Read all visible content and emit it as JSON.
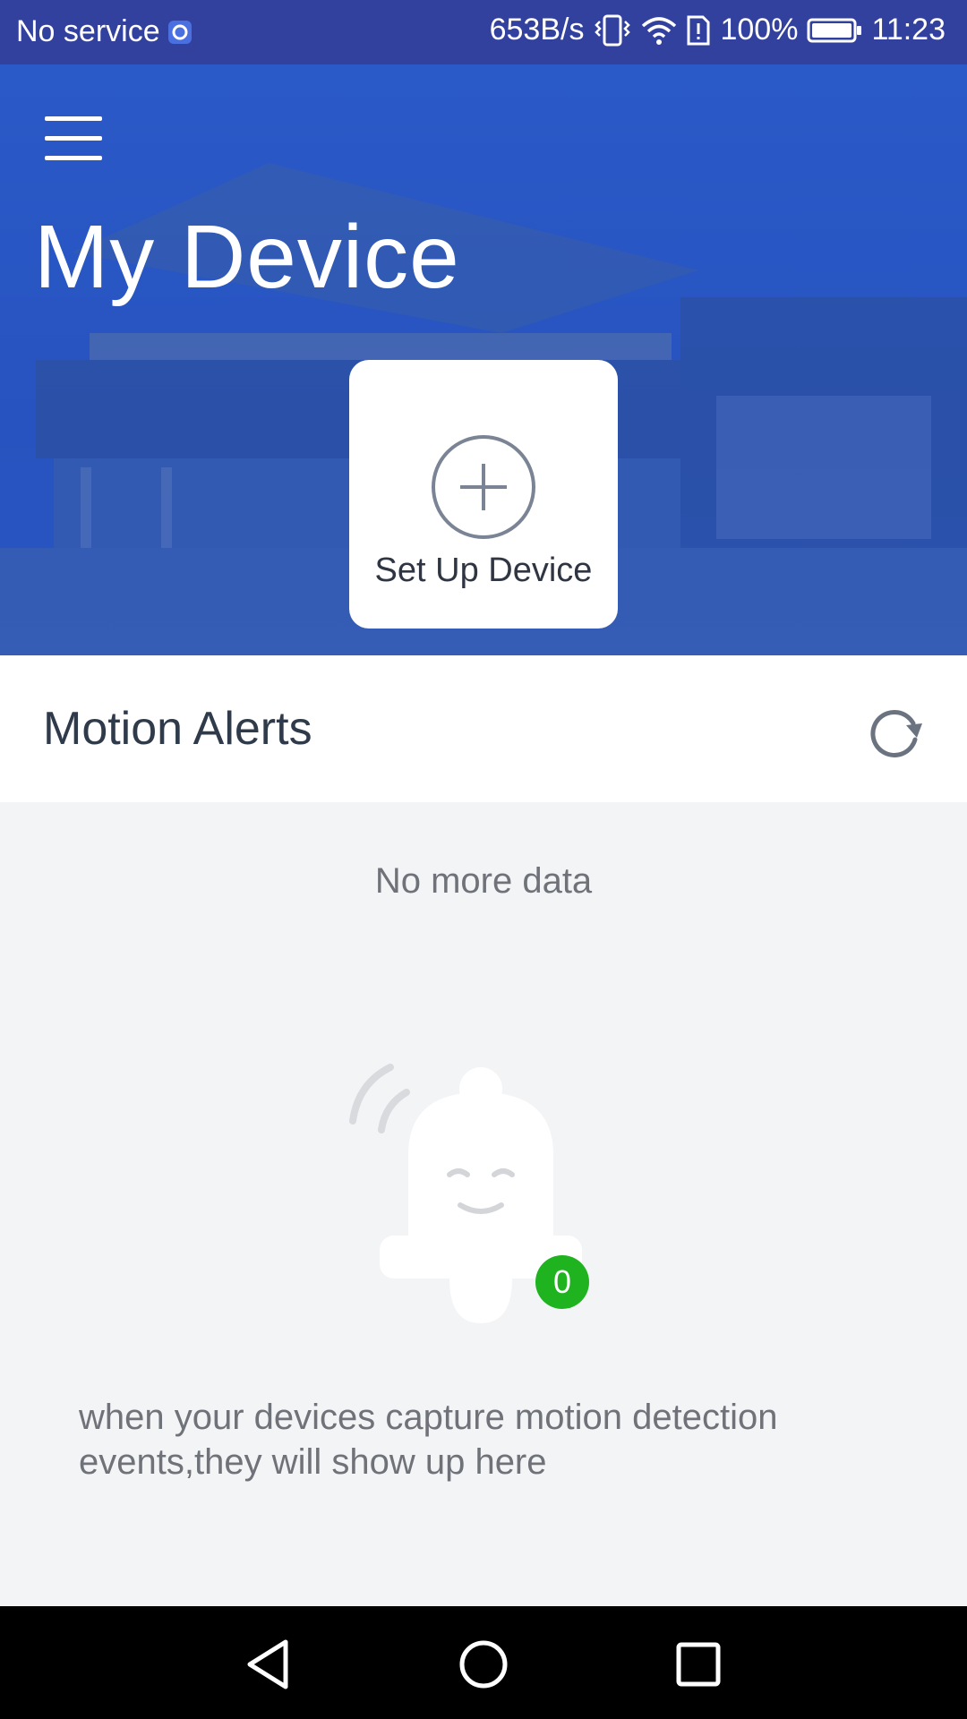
{
  "status_bar": {
    "carrier": "No service",
    "net_speed": "653B/s",
    "battery": "100%",
    "time": "11:23",
    "icons": [
      "sync-icon",
      "vibrate-icon",
      "wifi-icon",
      "sim-alert-icon",
      "battery-icon"
    ]
  },
  "header": {
    "menu_icon": "hamburger-menu-icon",
    "title": "My Device",
    "setup_card": {
      "icon": "plus-circle-icon",
      "label": "Set Up Device"
    }
  },
  "alerts": {
    "title": "Motion Alerts",
    "refresh_icon": "refresh-icon"
  },
  "empty_state": {
    "no_more": "No more data",
    "bell_icon": "smiling-bell-icon",
    "badge_count": "0",
    "message": "  when your devices capture motion detection\nevents,they will show up here"
  },
  "nav_bar": {
    "icons": [
      "back-triangle-icon",
      "home-circle-icon",
      "recents-square-icon"
    ]
  },
  "colors": {
    "status_bar": "#32409e",
    "header": "#2a5ac8",
    "badge": "#1fb31f"
  }
}
